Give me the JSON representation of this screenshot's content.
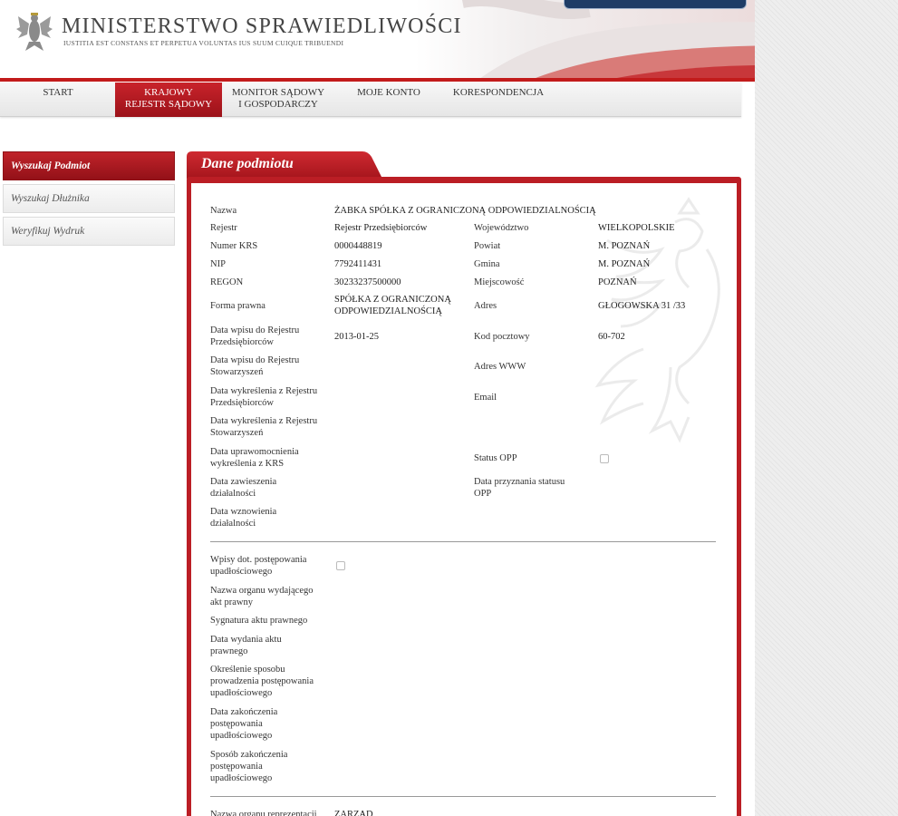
{
  "header": {
    "title": "MINISTERSTWO SPRAWIEDLIWOŚCI",
    "motto": "IUSTITIA EST CONSTANS ET PERPETUA VOLUNTAS IUS SUUM CUIQUE TRIBUENDI"
  },
  "nav": {
    "start": "START",
    "krs_line1": "KRAJOWY",
    "krs_line2": "REJESTR SĄDOWY",
    "monitor_line1": "MONITOR SĄDOWY",
    "monitor_line2": "I GOSPODARCZY",
    "account": "MOJE KONTO",
    "correspondence": "KORESPONDENCJA"
  },
  "sidebar": {
    "search_entity": "Wyszukaj Podmiot",
    "search_debtor": "Wyszukaj Dłużnika",
    "verify_printout": "Weryfikuj Wydruk"
  },
  "panel": {
    "title": "Dane podmiotu"
  },
  "entity": {
    "name_label": "Nazwa",
    "name_value": "ŻABKA SPÓŁKA Z OGRANICZONĄ ODPOWIEDZIALNOŚCIĄ",
    "register_label": "Rejestr",
    "register_value": "Rejestr Przedsiębiorców",
    "krs_label": "Numer KRS",
    "krs_value": "0000448819",
    "nip_label": "NIP",
    "nip_value": "7792411431",
    "regon_label": "REGON",
    "regon_value": "30233237500000",
    "legal_form_label": "Forma prawna",
    "legal_form_line1": "SPÓŁKA Z OGRANICZONĄ",
    "legal_form_line2": "ODPOWIEDZIALNOŚCIĄ",
    "entry_rp_line1": "Data wpisu do Rejestru",
    "entry_rp_line2": "Przedsiębiorców",
    "entry_rp_value": "2013-01-25",
    "entry_rs_line1": "Data wpisu do Rejestru",
    "entry_rs_line2": "Stowarzyszeń",
    "del_rp_line1": "Data wykreślenia z Rejestru",
    "del_rp_line2": "Przedsiębiorców",
    "del_rs_line1": "Data wykreślenia z Rejestru",
    "del_rs_line2": "Stowarzyszeń",
    "valid_del_line1": "Data uprawomocnienia",
    "valid_del_line2": "wykreślenia z KRS",
    "suspend_line1": "Data zawieszenia",
    "suspend_line2": "działalności",
    "resume_line1": "Data wznowienia",
    "resume_line2": "działalności",
    "voivodeship_label": "Województwo",
    "voivodeship_value": "WIELKOPOLSKIE",
    "county_label": "Powiat",
    "county_value": "M. POZNAŃ",
    "commune_label": "Gmina",
    "commune_value": "M. POZNAŃ",
    "locality_label": "Miejscowość",
    "locality_value": "POZNAŃ",
    "address_label": "Adres",
    "address_value": "GŁOGOWSKA 31 /33",
    "postal_label": "Kod pocztowy",
    "postal_value": "60-702",
    "www_label": "Adres WWW",
    "email_label": "Email",
    "opp_label": "Status OPP",
    "opp_date_line1": "Data przyznania statusu",
    "opp_date_line2": "OPP"
  },
  "bankruptcy": {
    "entries_line1": "Wpisy dot. postępowania",
    "entries_line2": "upadłościowego",
    "organ_line1": "Nazwa organu wydającego",
    "organ_line2": "akt prawny",
    "signature": "Sygnatura aktu prawnego",
    "issue_line1": "Data wydania aktu",
    "issue_line2": "prawnego",
    "method_line1": "Określenie sposobu",
    "method_line2": "prowadzenia postępowania",
    "method_line3": "upadłościowego",
    "end_line1": "Data zakończenia",
    "end_line2": "postępowania",
    "end_line3": "upadłościowego",
    "end_way_line1": "Sposób zakończenia",
    "end_way_line2": "postępowania",
    "end_way_line3": "upadłościowego"
  },
  "representation": {
    "organ_label": "Nazwa organu reprezentacji",
    "organ_value": "ZARZĄD"
  },
  "colors": {
    "accent_red": "#bb1e25",
    "navy": "#1e3c66"
  }
}
